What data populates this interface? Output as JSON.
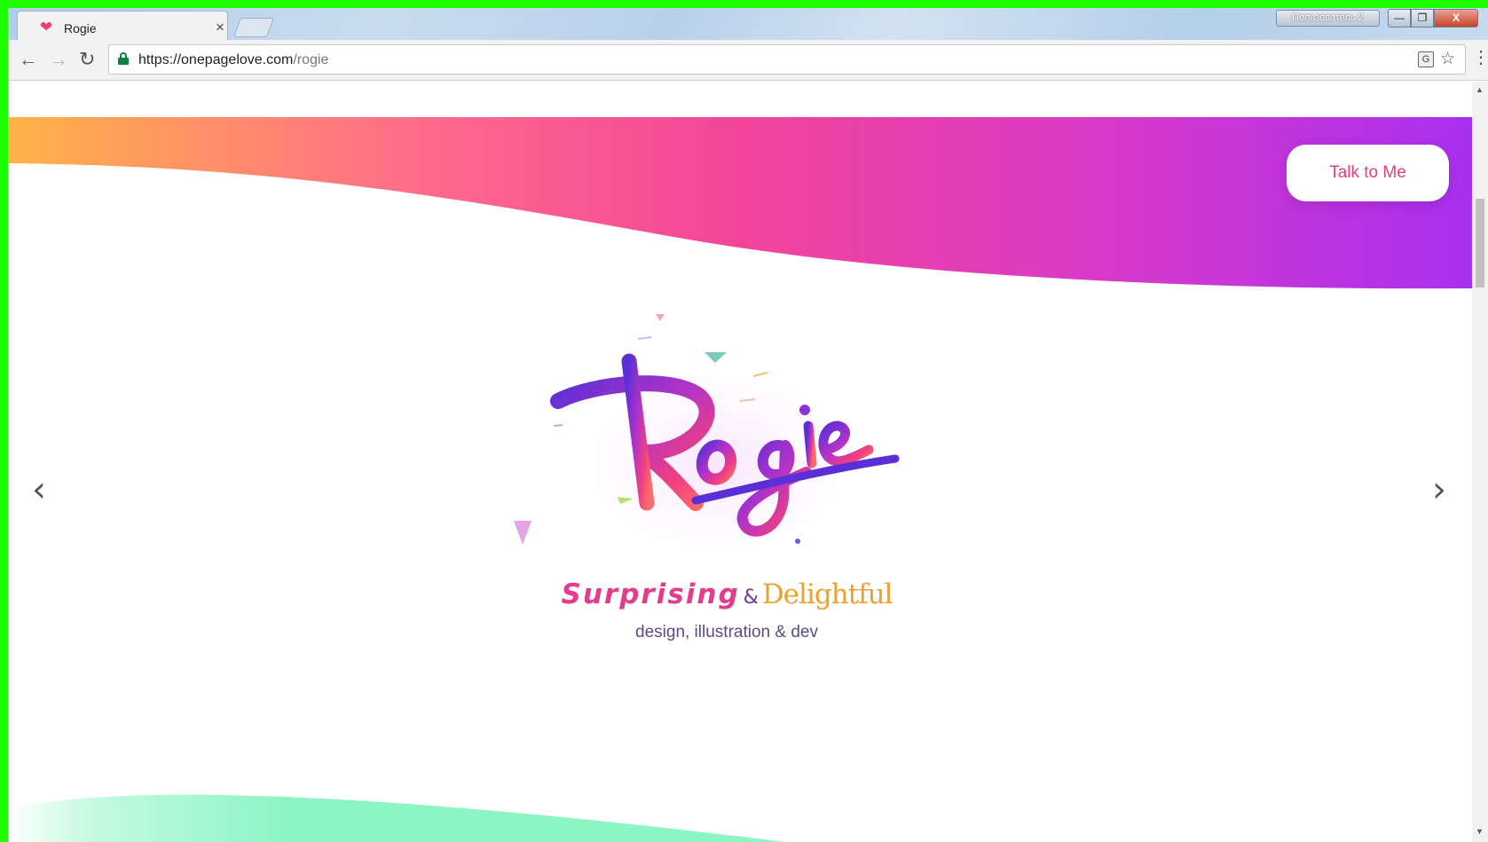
{
  "browser": {
    "tab_title": "Rogie",
    "tab_close": "×",
    "profile_label": "Пользователь 2",
    "window_min": "—",
    "window_max": "❐",
    "window_close": "X",
    "nav_back": "←",
    "nav_forward": "→",
    "nav_reload": "↻",
    "url_host": "https://onepagelove.com",
    "url_path": "/rogie",
    "translate_icon": "G",
    "star_icon": "☆",
    "menu_icon": "⋮"
  },
  "page": {
    "talk_button": "Talk to Me",
    "prev_arrow": "‹",
    "next_arrow": "›",
    "logo_text": "Rogie",
    "tagline_surprising": "Surprising",
    "tagline_amp": "&",
    "tagline_delightful": "Delightful",
    "subtitle": "design, illustration & dev"
  },
  "colors": {
    "hero_gradient": [
      "#ffb347",
      "#ff6b8b",
      "#f2459a",
      "#d839c9",
      "#a930f0"
    ],
    "accent_pink": "#e5407a",
    "logo_purple": "#6a2fd0",
    "green_wave": "#8cf5c4"
  }
}
